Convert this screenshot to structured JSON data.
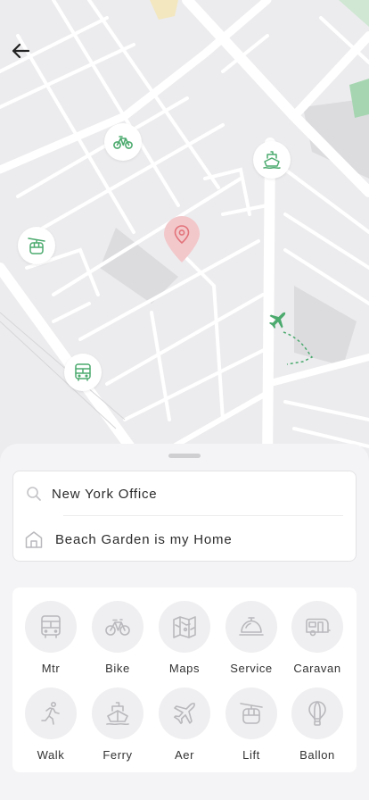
{
  "colors": {
    "accent_green": "#4caa6e",
    "marker_red": "#e2737a",
    "icon_grey": "#b9b9bd",
    "map_bg": "#ececee",
    "road": "#ffffff"
  },
  "map": {
    "back_icon": "arrow-left-icon",
    "pins": [
      {
        "name": "bike",
        "icon": "bicycle-icon"
      },
      {
        "name": "ferry",
        "icon": "ship-icon"
      },
      {
        "name": "lift",
        "icon": "cable-car-icon"
      },
      {
        "name": "plane",
        "icon": "airplane-icon"
      },
      {
        "name": "bus",
        "icon": "bus-icon"
      }
    ],
    "current_location_icon": "location-pin-icon"
  },
  "route": {
    "from": {
      "icon": "search-icon",
      "text": "New York Office"
    },
    "to": {
      "icon": "home-icon",
      "text": "Beach Garden is my Home"
    }
  },
  "modes": [
    {
      "label": "Mtr",
      "icon": "bus-icon"
    },
    {
      "label": "Bike",
      "icon": "bicycle-icon"
    },
    {
      "label": "Maps",
      "icon": "map-icon"
    },
    {
      "label": "Service",
      "icon": "service-bell-icon"
    },
    {
      "label": "Caravan",
      "icon": "caravan-icon"
    },
    {
      "label": "Walk",
      "icon": "walking-icon"
    },
    {
      "label": "Ferry",
      "icon": "ship-icon"
    },
    {
      "label": "Aer",
      "icon": "airplane-icon"
    },
    {
      "label": "Lift",
      "icon": "cable-car-icon"
    },
    {
      "label": "Ballon",
      "icon": "hot-air-balloon-icon"
    }
  ]
}
